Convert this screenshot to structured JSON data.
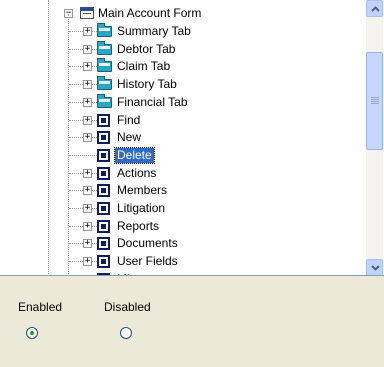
{
  "tree": {
    "root": {
      "label": "Main Account Form",
      "expander": "−",
      "icon": "form-icon"
    },
    "items": [
      {
        "label": "Summary Tab",
        "icon": "folder-icon",
        "expander": "+"
      },
      {
        "label": "Debtor Tab",
        "icon": "folder-icon",
        "expander": "+"
      },
      {
        "label": "Claim Tab",
        "icon": "folder-icon",
        "expander": "+"
      },
      {
        "label": "History Tab",
        "icon": "folder-icon",
        "expander": "+"
      },
      {
        "label": "Financial Tab",
        "icon": "folder-icon",
        "expander": "+"
      },
      {
        "label": "Find",
        "icon": "command-icon",
        "expander": "+"
      },
      {
        "label": "New",
        "icon": "command-icon",
        "expander": "+"
      },
      {
        "label": "Delete",
        "icon": "command-icon",
        "expander": "",
        "selected": true
      },
      {
        "label": "Actions",
        "icon": "command-icon",
        "expander": "+"
      },
      {
        "label": "Members",
        "icon": "command-icon",
        "expander": "+"
      },
      {
        "label": "Litigation",
        "icon": "command-icon",
        "expander": "+"
      },
      {
        "label": "Reports",
        "icon": "command-icon",
        "expander": "+"
      },
      {
        "label": "Documents",
        "icon": "command-icon",
        "expander": "+"
      },
      {
        "label": "User Fields",
        "icon": "command-icon",
        "expander": "+"
      },
      {
        "label": "Mi",
        "icon": "command-icon",
        "expander": "+"
      }
    ]
  },
  "state": {
    "enabled_label": "Enabled",
    "disabled_label": "Disabled",
    "selected": "Enabled"
  },
  "colors": {
    "selection": "#316ac5",
    "panel": "#ece9d8",
    "scrollbar": "#c1d3fb"
  }
}
